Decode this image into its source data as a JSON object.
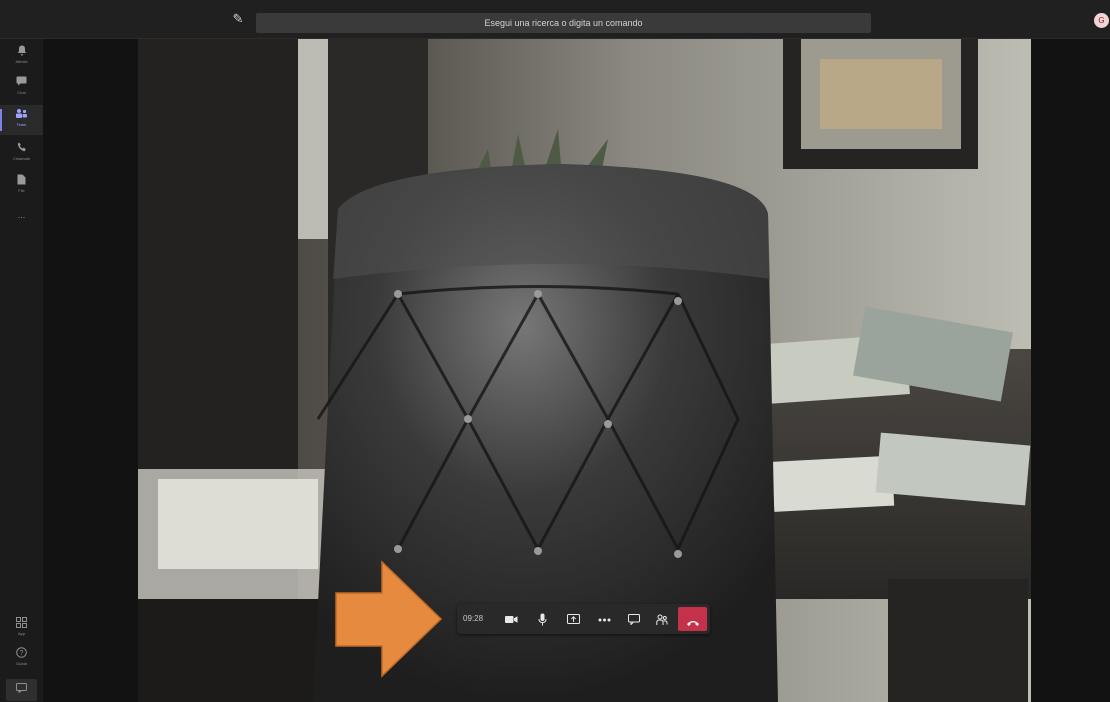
{
  "top_bar": {
    "compose_icon": "compose-icon",
    "search_placeholder": "Esegui una ricerca o digita un comando",
    "avatar_initial": "G"
  },
  "sidebar": {
    "items": [
      {
        "label": "Attività",
        "icon": "bell-icon"
      },
      {
        "label": "Chat",
        "icon": "chat-icon"
      },
      {
        "label": "Team",
        "icon": "teams-icon",
        "active": true
      },
      {
        "label": "Chiamate",
        "icon": "phone-icon"
      },
      {
        "label": "File",
        "icon": "file-icon"
      },
      {
        "label": "...",
        "icon": "more-icon"
      }
    ],
    "bottom_items": [
      {
        "label": "App",
        "icon": "apps-icon"
      },
      {
        "label": "Guida",
        "icon": "help-icon"
      }
    ]
  },
  "call_controls": {
    "timer": "09:28",
    "buttons": [
      "camera-icon",
      "microphone-icon",
      "share-screen-icon",
      "more-actions-icon",
      "chat-icon",
      "participants-icon",
      "hang-up-icon"
    ]
  },
  "colors": {
    "accent": "#7b83eb",
    "hangup": "#c4314b",
    "arrow": "#e58a3e"
  }
}
